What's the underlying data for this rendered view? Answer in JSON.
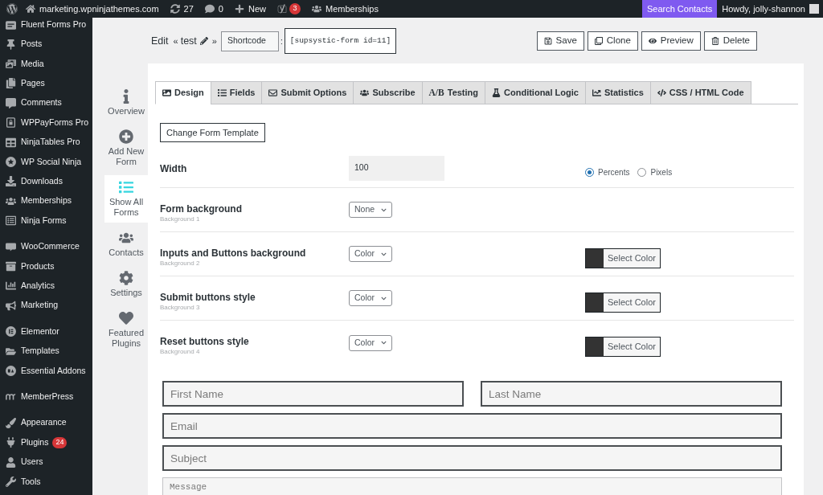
{
  "admin_bar": {
    "items": [
      {
        "kind": "link",
        "label": "marketing.wpninjathemes.com"
      },
      {
        "kind": "link",
        "label": "27"
      },
      {
        "kind": "link",
        "label": "0"
      },
      {
        "kind": "link",
        "label": "New"
      },
      {
        "kind": "badge",
        "badge": "3"
      },
      {
        "kind": "link",
        "label": "Memberships"
      }
    ],
    "search": "Search Contacts",
    "account": "Howdy, jolly-shannon"
  },
  "sidebar": {
    "groups": [
      [
        {
          "label": "Fluent Forms Pro"
        }
      ],
      [
        {
          "label": "Posts"
        },
        {
          "label": "Media"
        },
        {
          "label": "Pages"
        },
        {
          "label": "Comments"
        },
        {
          "label": "WPPayForms Pro"
        },
        {
          "label": "NinjaTables Pro"
        },
        {
          "label": "WP Social Ninja"
        },
        {
          "label": "Downloads"
        },
        {
          "label": "Memberships"
        },
        {
          "label": "Ninja Forms"
        }
      ],
      [
        {
          "label": "WooCommerce"
        },
        {
          "label": "Products"
        },
        {
          "label": "Analytics"
        },
        {
          "label": "Marketing"
        }
      ],
      [
        {
          "label": "Elementor"
        },
        {
          "label": "Templates"
        },
        {
          "label": "Essential Addons"
        }
      ],
      [
        {
          "label": "MemberPress"
        }
      ],
      [
        {
          "label": "Appearance"
        },
        {
          "label": "Plugins",
          "badge": "24"
        },
        {
          "label": "Users"
        },
        {
          "label": "Tools"
        }
      ]
    ]
  },
  "header": {
    "edit": "Edit",
    "title_open": "«",
    "title": "test",
    "title_close": "»",
    "shortcode_select": "Shortcode",
    "shortcode_separator": ":",
    "shortcode": "[supsystic-form id=11]",
    "actions": [
      "Save",
      "Clone",
      "Preview",
      "Delete"
    ]
  },
  "plugin_nav": [
    {
      "label": "Overview",
      "selected": false
    },
    {
      "label": "Add New Form",
      "selected": false
    },
    {
      "label": "Show All Forms",
      "selected": true
    },
    {
      "label": "Contacts",
      "selected": false
    },
    {
      "label": "Settings",
      "selected": false
    },
    {
      "label": "Featured Plugins",
      "selected": false
    }
  ],
  "tabs": [
    {
      "label": "Design",
      "selected": true
    },
    {
      "label": "Fields",
      "selected": false
    },
    {
      "label": "Submit Options",
      "selected": false
    },
    {
      "label": "Subscribe",
      "selected": false
    },
    {
      "glyph": "A/B",
      "label": "Testing",
      "selected": false
    },
    {
      "label": "Conditional Logic",
      "selected": false
    },
    {
      "label": "Statistics",
      "selected": false
    },
    {
      "label": "CSS / HTML Code",
      "selected": false
    }
  ],
  "design": {
    "change_template": "Change Form Template",
    "rows": [
      {
        "kind": "width",
        "label": "Width",
        "value": "100",
        "units": [
          {
            "label": "Percents",
            "selected": true
          },
          {
            "label": "Pixels",
            "selected": false
          }
        ]
      },
      {
        "kind": "background",
        "label": "Form background",
        "sublabel": "Background 1",
        "select": "None"
      },
      {
        "kind": "background",
        "label": "Inputs and Buttons background",
        "sublabel": "Background 2",
        "select": "Color",
        "color_button": "Select Color"
      },
      {
        "kind": "background",
        "label": "Submit buttons style",
        "sublabel": "Background 3",
        "select": "Color",
        "color_button": "Select Color"
      },
      {
        "kind": "background",
        "label": "Reset buttons style",
        "sublabel": "Background 4",
        "select": "Color",
        "color_button": "Select Color"
      }
    ]
  },
  "preview": {
    "rows": [
      [
        {
          "kind": "input",
          "placeholder": "First Name"
        },
        {
          "kind": "input",
          "placeholder": "Last Name"
        }
      ],
      [
        {
          "kind": "input",
          "placeholder": "Email"
        }
      ],
      [
        {
          "kind": "input",
          "placeholder": "Subject"
        }
      ],
      [
        {
          "kind": "textarea",
          "placeholder": "Message"
        }
      ]
    ]
  }
}
